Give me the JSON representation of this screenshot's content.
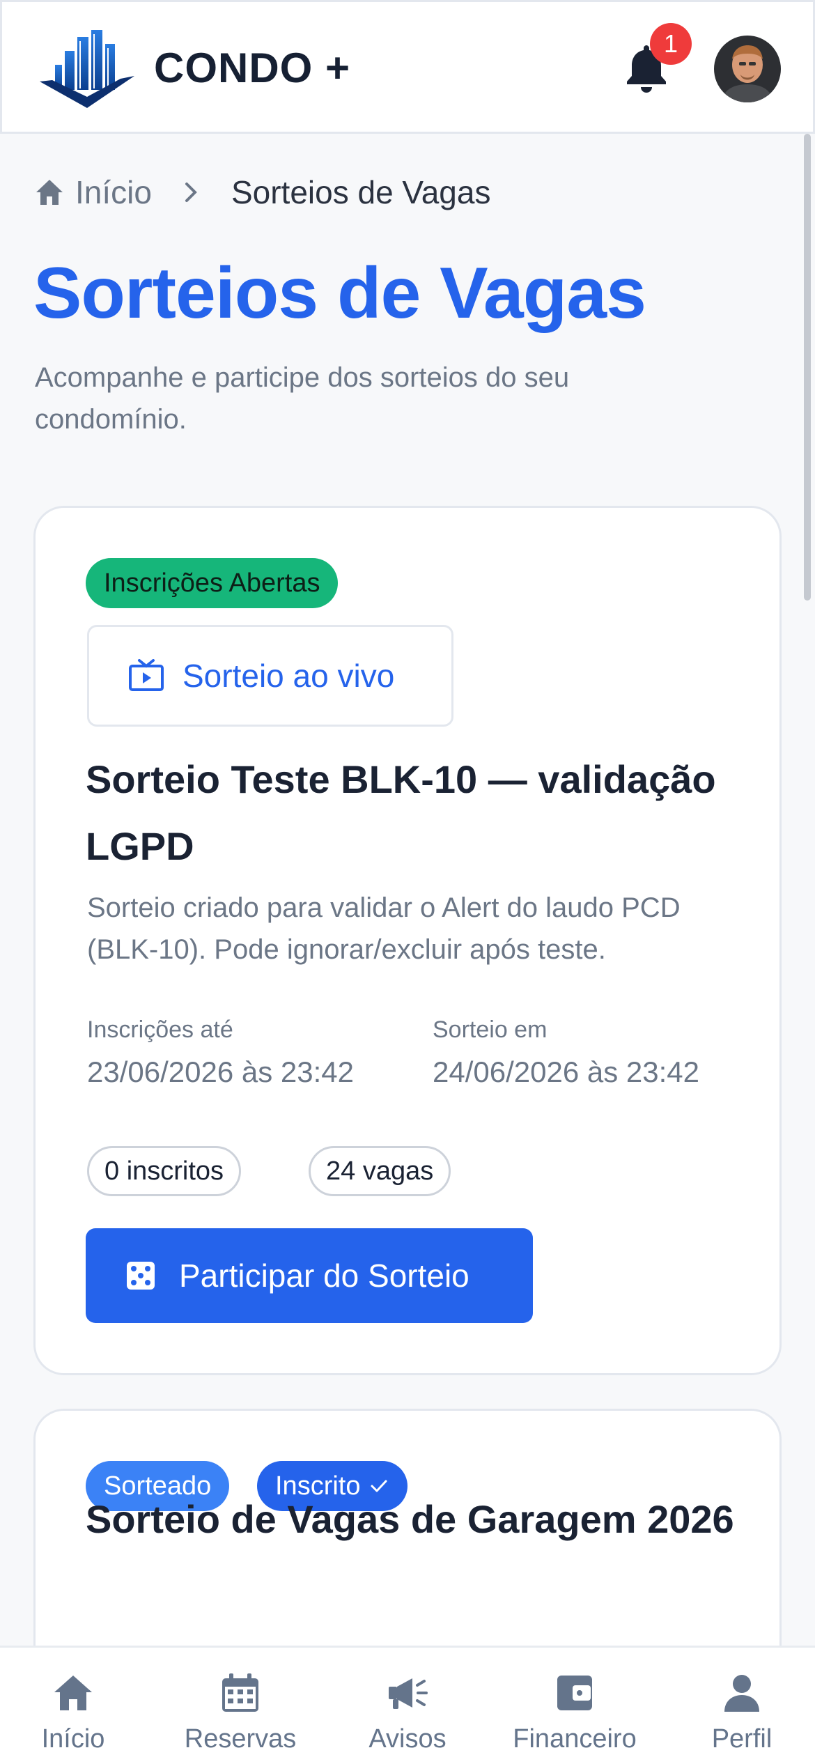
{
  "header": {
    "brand": "CONDO +",
    "notification_count": "1"
  },
  "breadcrumb": {
    "home": "Início",
    "current": "Sorteios de Vagas"
  },
  "page": {
    "title": "Sorteios de Vagas",
    "subtitle": "Acompanhe e participe dos sorteios do seu condomínio."
  },
  "raffles": [
    {
      "status": "Inscrições Abertas",
      "live_label": "Sorteio ao vivo",
      "title": "Sorteio Teste BLK-10 — validação LGPD",
      "description": "Sorteio criado para validar o Alert do laudo PCD (BLK-10). Pode ignorar/excluir após teste.",
      "registration_label": "Inscrições até",
      "registration_date": "23/06/2026 às 23:42",
      "draw_label": "Sorteio em",
      "draw_date": "24/06/2026 às 23:42",
      "enrolled": "0 inscritos",
      "spots": "24 vagas",
      "cta": "Participar do Sorteio"
    },
    {
      "status": "Sorteado",
      "enrolled_status": "Inscrito",
      "title": "Sorteio de Vagas de Garagem 2026"
    }
  ],
  "bottom_nav": [
    {
      "label": "Início",
      "icon": "home-icon"
    },
    {
      "label": "Reservas",
      "icon": "calendar-icon"
    },
    {
      "label": "Avisos",
      "icon": "megaphone-icon"
    },
    {
      "label": "Financeiro",
      "icon": "wallet-icon"
    },
    {
      "label": "Perfil",
      "icon": "user-icon"
    }
  ],
  "colors": {
    "primary": "#2563eb",
    "open_status": "#16b67a",
    "drawn_status": "#3b82f6",
    "badge": "#ef3b3b",
    "muted_text": "#6b7686"
  }
}
